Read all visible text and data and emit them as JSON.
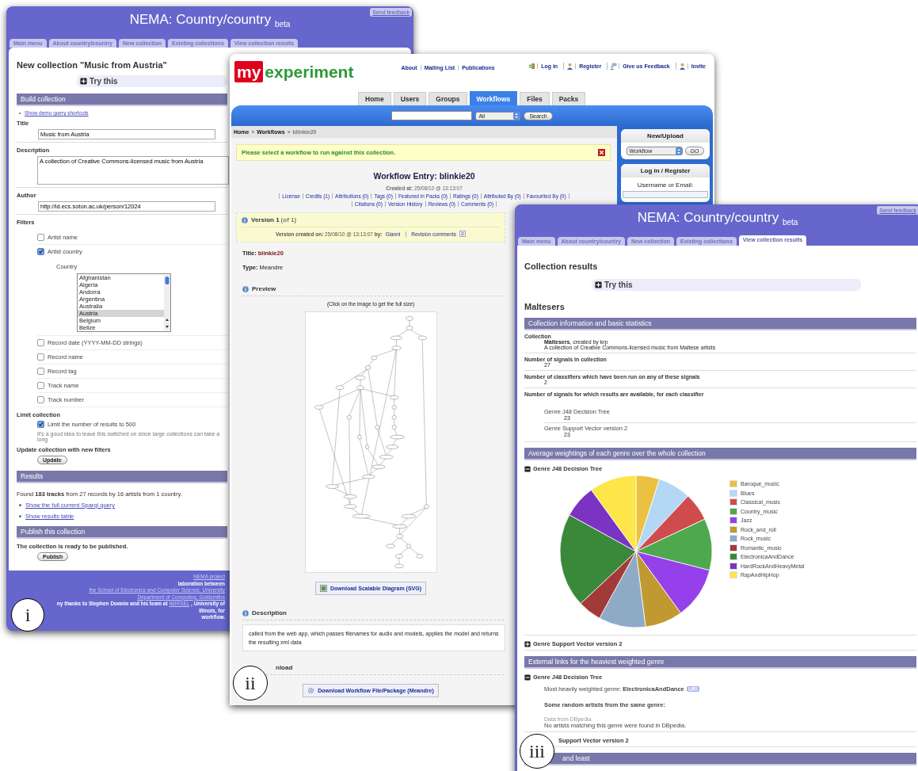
{
  "figure_labels": [
    "i",
    "ii",
    "iii"
  ],
  "collection_window": {
    "title": "NEMA: Country/country",
    "title_suffix": "beta",
    "feedback_link": "Send feedback",
    "tabs": [
      {
        "label": "Main menu",
        "selected": false
      },
      {
        "label": "About country/country",
        "selected": false
      },
      {
        "label": "New collection",
        "selected": false
      },
      {
        "label": "Existing collections",
        "selected": false
      },
      {
        "label": "View collection results",
        "selected": false
      }
    ],
    "heading": "New collection \"Music from Austria\"",
    "try_this": {
      "label": "Try this",
      "expanded": false
    },
    "build_section": "Build collection",
    "demo_link": "Show demo query shortcuts",
    "fields": [
      {
        "label": "Title",
        "value": "Music from Austria",
        "kind": "text"
      },
      {
        "label": "Description",
        "value": "A collection of Creative Commons-licensed music from Austria",
        "kind": "textarea"
      },
      {
        "label": "Author",
        "value": "http://id.ecs.soton.ac.uk/person/12024",
        "kind": "text"
      }
    ],
    "filters_label": "Filters",
    "filters": [
      {
        "label": "Artist name",
        "checked": false
      },
      {
        "label": "Artist country",
        "checked": true,
        "list_label": "Country",
        "options": [
          {
            "label": "Afghanistan",
            "selected": false
          },
          {
            "label": "Algeria",
            "selected": false
          },
          {
            "label": "Andorra",
            "selected": false
          },
          {
            "label": "Argentina",
            "selected": false
          },
          {
            "label": "Australia",
            "selected": false
          },
          {
            "label": "Austria",
            "selected": true
          },
          {
            "label": "Belgium",
            "selected": false
          },
          {
            "label": "Belize",
            "selected": false
          }
        ]
      },
      {
        "label": "Record date (YYYY-MM-DD strings)",
        "checked": false
      },
      {
        "label": "Record name",
        "checked": false
      },
      {
        "label": "Record tag",
        "checked": false
      },
      {
        "label": "Track name",
        "checked": false
      },
      {
        "label": "Track number",
        "checked": false
      }
    ],
    "limit": {
      "label": "Limit collection",
      "option": "Limit the number of results to 500",
      "checked": true,
      "note": "It's a good idea to leave this switched on since large collections can take a long"
    },
    "update": {
      "label": "Update collection with new filters",
      "button": "Update"
    },
    "results_section": "Results",
    "results_summary": "Found **183 tracks** from 27 records by 16 artists from 1 country.",
    "result_links": [
      "Show the full current Sparql query",
      "Show results table"
    ],
    "publish_section": "Publish this collection",
    "publish_status": "The collection is ready to be published.",
    "publish_button": "Publish",
    "footer": [
      [
        {
          "kind": "link",
          "text": "NEMA project"
        }
      ],
      [
        {
          "kind": "bold",
          "text": "laboration between"
        },
        {
          "kind": "link",
          "text": "the School of Electronics and Computer Science, University"
        }
      ],
      [
        {
          "kind": "link",
          "text": "Department of Computing, Goldsmiths"
        }
      ],
      [
        {
          "kind": "bold",
          "text": "ny thanks to Stephen Downie and his team at"
        },
        {
          "kind": "link",
          "text": "IMIRSEL"
        },
        {
          "kind": "bold",
          "text": ", University of Illinois, for"
        }
      ],
      [
        {
          "kind": "bold",
          "text": "workflow."
        }
      ]
    ]
  },
  "experiment_window": {
    "logo": {
      "prefix": "my",
      "name": "experiment"
    },
    "top_links": [
      "About",
      "Mailing List",
      "Publications"
    ],
    "user_links": [
      {
        "label": "Log in",
        "kind": "login"
      },
      {
        "label": "Register",
        "kind": "user"
      },
      {
        "label": "Give us Feedback",
        "kind": "feedback"
      },
      {
        "label": "Invite",
        "kind": "user"
      }
    ],
    "tabs": [
      {
        "label": "Home",
        "selected": false
      },
      {
        "label": "Users",
        "selected": false
      },
      {
        "label": "Groups",
        "selected": false
      },
      {
        "label": "Workflows",
        "selected": true
      },
      {
        "label": "Files",
        "selected": false
      },
      {
        "label": "Packs",
        "selected": false
      }
    ],
    "search": {
      "filter": "All",
      "button": "Search"
    },
    "breadcrumb": {
      "separator": "»",
      "items": [
        "Home",
        "Workflows",
        "blinkie20"
      ]
    },
    "notice": "Please select a workflow to run against this collection.",
    "heading": "Workflow Entry: blinkie20",
    "created": "**Created at:** 25/08/10 @ 13:13:07",
    "entry_links": [
      [
        "License",
        "Credits (1)",
        "Attributions (0)",
        "Tags (0)",
        "Featured in Packs (0)",
        "Ratings (0)",
        "Attributed By (0)",
        "Favourited By (0)"
      ],
      [
        "Citations (0)",
        "Version History",
        "Reviews (0)",
        "Comments (0)"
      ]
    ],
    "version": {
      "title": "Version 1",
      "count": "(of 1)",
      "created": "**Version created on:** 25/08/10 @ 13:13:07 **by:**",
      "author": "Gianni",
      "comments_link": "Revision comments"
    },
    "properties": [
      {
        "label": "Title:",
        "value": "blinkie20",
        "kind": "name"
      },
      {
        "label": "Type:",
        "value": "Meandre",
        "kind": "plain"
      }
    ],
    "preview": {
      "heading": "Preview",
      "hint": "(Click on the image to get the full size)",
      "button": "Download Scalable Diagram (SVG)"
    },
    "description": {
      "heading": "Description",
      "text": "called from the web app, which passes filenames for audio and models, applies the model and returns the resulting xml data"
    },
    "download": {
      "heading": "nload",
      "button": "Download Workflow File/Package (Meandre)"
    },
    "sidebar": {
      "new_heading": "New/Upload",
      "new_type": "Workflow",
      "go_button": "GO",
      "login_heading": "Log in / Register",
      "username_label": "Username or Email:"
    }
  },
  "results_window": {
    "title": "NEMA: Country/country",
    "title_suffix": "beta",
    "feedback_link": "Send feedback",
    "tabs": [
      {
        "label": "Main menu",
        "selected": false
      },
      {
        "label": "About country/country",
        "selected": false
      },
      {
        "label": "New collection",
        "selected": false
      },
      {
        "label": "Existing collections",
        "selected": false
      },
      {
        "label": "View collection results",
        "selected": true
      }
    ],
    "heading": "Collection results",
    "try_this": {
      "label": "Try this",
      "expanded": false
    },
    "collection_name": "Maltesers",
    "info_section": "Collection information and basic statistics",
    "stats": [
      {
        "label": "Collection",
        "kind": "collection",
        "value": "**Maltesers**, created by krp",
        "detail": "A collection of Creative Commons-licensed music from Maltese artists"
      },
      {
        "label": "Number of signals in collection",
        "kind": "number",
        "value": "27"
      },
      {
        "label": "Number of classifiers which have been run on any of these signals",
        "kind": "number",
        "value": "2"
      },
      {
        "label": "Number of signals for which results are available, for each classifier",
        "kind": "classifiers",
        "items": [
          {
            "name": "Genre J48 Decision Tree",
            "value": "23"
          },
          {
            "name": "Genre Support Vector version 2",
            "value": "23"
          }
        ]
      }
    ],
    "weights_section": "Average weightings of each genre over the whole collection",
    "classifiers": [
      {
        "name": "Genre J48 Decision Tree",
        "expanded": true,
        "legend": [
          {
            "label": "Baroque_music",
            "color": "#ecc040"
          },
          {
            "label": "Blues",
            "color": "#b2d8f6"
          },
          {
            "label": "Classical_music",
            "color": "#d04c4c"
          },
          {
            "label": "Country_music",
            "color": "#4ea84e"
          },
          {
            "label": "Jazz",
            "color": "#9540ea"
          },
          {
            "label": "Rock_and_roll",
            "color": "#c09a30"
          },
          {
            "label": "Rock_music",
            "color": "#8eabc6"
          },
          {
            "label": "Romantic_music",
            "color": "#a33a3a"
          },
          {
            "label": "ElectronicaAndDance",
            "color": "#3a883a"
          },
          {
            "label": "HardRockAndHeavyMetal",
            "color": "#7a33c2"
          },
          {
            "label": "RapAndHipHop",
            "color": "#fde54a"
          }
        ]
      },
      {
        "name": "Genre Support Vector version 2",
        "expanded": false
      }
    ],
    "links_section": "External links for the heaviest weighted genre",
    "link_classifiers": [
      {
        "name": "Genre J48 Decision Tree",
        "expanded": true,
        "genre_text": "Most heavily weighted genre: **ElectronicaAndDance**",
        "uri_badge": "URI",
        "artists_heading": "Some random artists from the same genre:",
        "source": "Data from DBpedia",
        "message": "No artists matching this genre were found in DBpedia."
      },
      {
        "name": "Support Vector version 2"
      }
    ],
    "last_section": "and least"
  }
}
